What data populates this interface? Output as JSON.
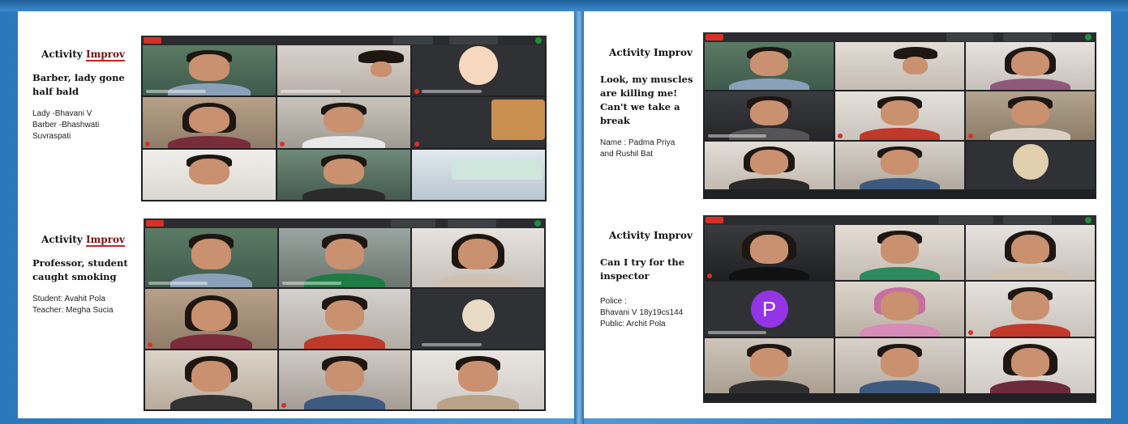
{
  "left": {
    "sections": [
      {
        "title_prefix": "Activity",
        "title_highlight": "Improv",
        "scene": "Barber, lady gone half bald",
        "cast": [
          "Lady -Bhavani V",
          "Barber -Bhashwati",
          "Suvraspati"
        ]
      },
      {
        "title_prefix": "Activity",
        "title_highlight": "Improv",
        "scene": "Professor, student caught smoking",
        "cast": [
          "Student: Avahit Pola",
          "Teacher: Megha Sucia"
        ]
      }
    ]
  },
  "right": {
    "sections": [
      {
        "title_prefix": "Activity",
        "title_highlight": "Improv",
        "scene": "Look, my muscles are killing me! Can't we take a break",
        "cast": [
          "Name : Padma Priya",
          "and Rushil Bat"
        ]
      },
      {
        "title_prefix": "Activity",
        "title_highlight": "Improv",
        "scene": "Can I try for the inspector",
        "cast": [
          "Police :",
          "Bhavani V 18y19cs144",
          "Public: Archit Pola"
        ]
      }
    ]
  },
  "meet": {
    "avatar_letter": "P"
  },
  "colors": {
    "frame": "#2f7fc1",
    "meet_bg": "#202124",
    "record": "#d93025",
    "accent_dot": "#1e8e3e",
    "avatar": "#9334e6",
    "highlight_underline": "#cc2222"
  }
}
